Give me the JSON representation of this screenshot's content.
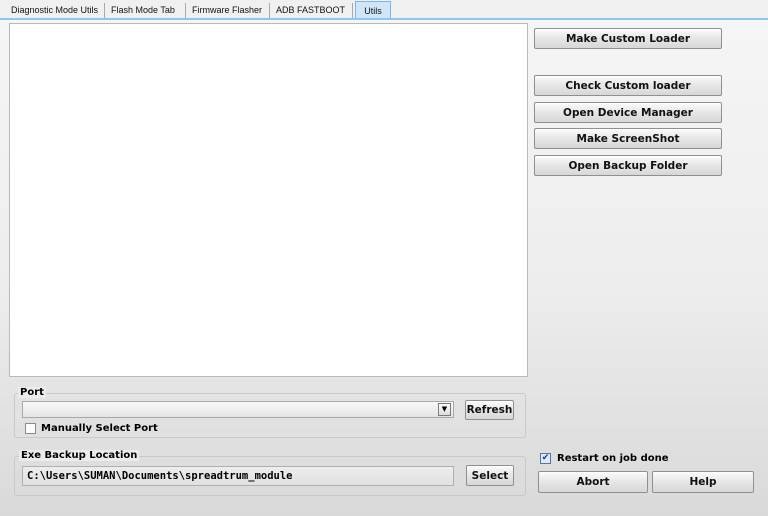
{
  "tabs": [
    {
      "label": "Diagnostic Mode Utils"
    },
    {
      "label": "Flash Mode Tab"
    },
    {
      "label": "Firmware Flasher"
    },
    {
      "label": "ADB FASTBOOT"
    },
    {
      "label": "Utils"
    }
  ],
  "right_panel": {
    "make_custom_loader": "Make Custom Loader",
    "check_custom_loader": "Check Custom loader",
    "open_device_manager": "Open Device Manager",
    "make_screenshot": "Make ScreenShot",
    "open_backup_folder": "Open Backup Folder"
  },
  "port": {
    "title": "Port",
    "selected": "",
    "refresh_label": "Refresh",
    "manual_label": "Manually Select Port",
    "manual_checked": false
  },
  "backup": {
    "title": "Exe Backup Location",
    "path": "C:\\Users\\SUMAN\\Documents\\spreadtrum_module",
    "select_label": "Select"
  },
  "bottom_right": {
    "restart_label": "Restart on job done",
    "restart_checked": true,
    "abort_label": "Abort",
    "help_label": "Help"
  },
  "icons": {
    "combo": "chevron-down-icon",
    "check": "checkmark-icon"
  }
}
